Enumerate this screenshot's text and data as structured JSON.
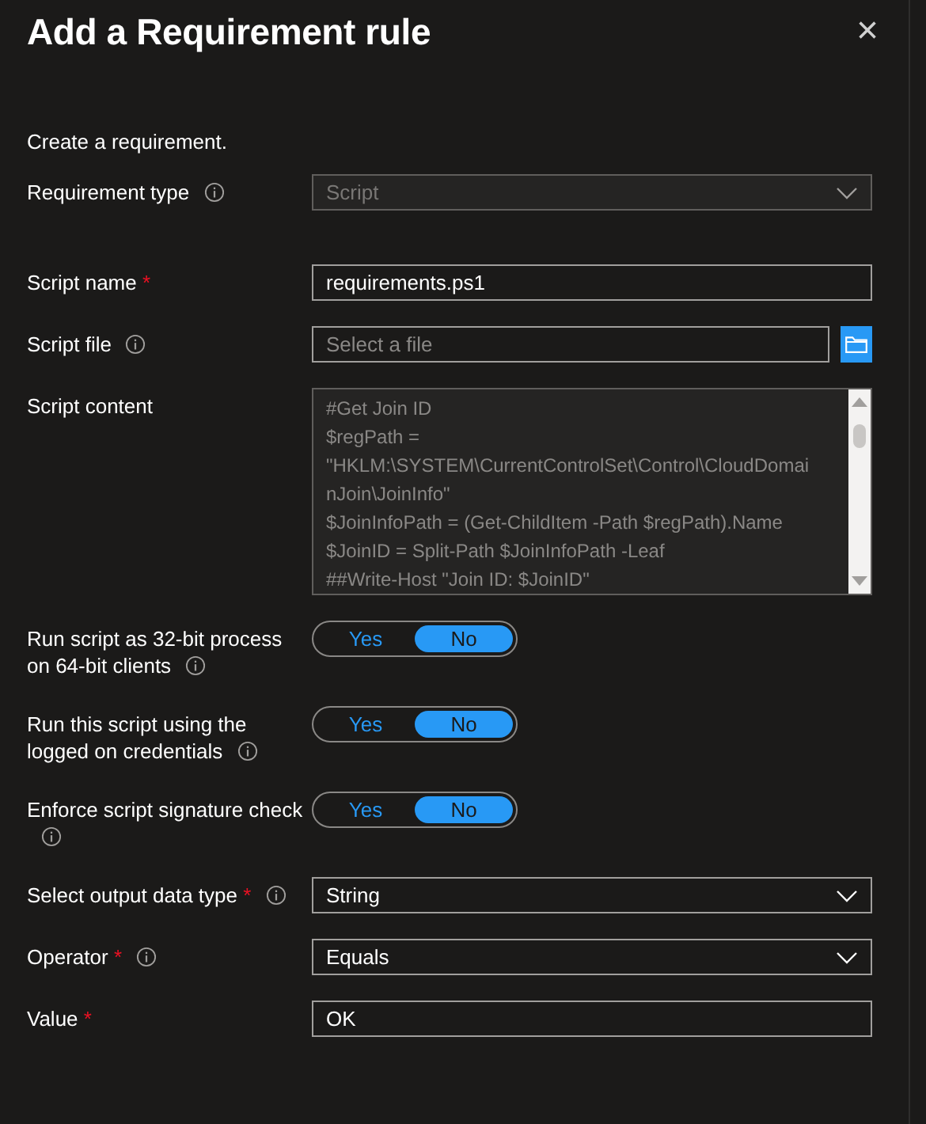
{
  "panel": {
    "title": "Add a Requirement rule",
    "close": "×"
  },
  "intro": "Create a requirement.",
  "fields": [
    {
      "kind": "dropdown",
      "label": "Requirement type",
      "info": true,
      "value": "Script",
      "disabled": true
    },
    {
      "kind": "text",
      "label": "Script name",
      "required_mark": "*",
      "info": false,
      "value": "requirements.ps1"
    },
    {
      "kind": "file",
      "label": "Script file",
      "info": true,
      "placeholder": "Select a file"
    },
    {
      "kind": "textarea",
      "label": "Script content",
      "info": false,
      "lines": [
        "#Get Join ID",
        "$regPath =",
        "\"HKLM:\\SYSTEM\\CurrentControlSet\\Control\\CloudDomai",
        "nJoin\\JoinInfo\"",
        "$JoinInfoPath = (Get-ChildItem -Path $regPath).Name",
        "$JoinID = Split-Path $JoinInfoPath -Leaf",
        "##Write-Host \"Join ID: $JoinID\""
      ]
    },
    {
      "kind": "toggle",
      "label": "Run script as 32-bit process on 64-bit clients",
      "info": true,
      "options": [
        {
          "label": "Yes",
          "selected": false
        },
        {
          "label": "No",
          "selected": true
        }
      ]
    },
    {
      "kind": "toggle",
      "label": "Run this script using the logged on credentials",
      "info": true,
      "options": [
        {
          "label": "Yes",
          "selected": false
        },
        {
          "label": "No",
          "selected": true
        }
      ]
    },
    {
      "kind": "toggle",
      "label": "Enforce script signature check",
      "info": true,
      "options": [
        {
          "label": "Yes",
          "selected": false
        },
        {
          "label": "No",
          "selected": true
        }
      ]
    },
    {
      "kind": "dropdown",
      "label": "Select output data type",
      "required_mark": "*",
      "info": true,
      "value": "String",
      "disabled": false
    },
    {
      "kind": "dropdown",
      "label": "Operator",
      "required_mark": "*",
      "info": true,
      "value": "Equals",
      "disabled": false
    },
    {
      "kind": "text",
      "label": "Value",
      "required_mark": "*",
      "info": false,
      "value": "OK"
    }
  ]
}
